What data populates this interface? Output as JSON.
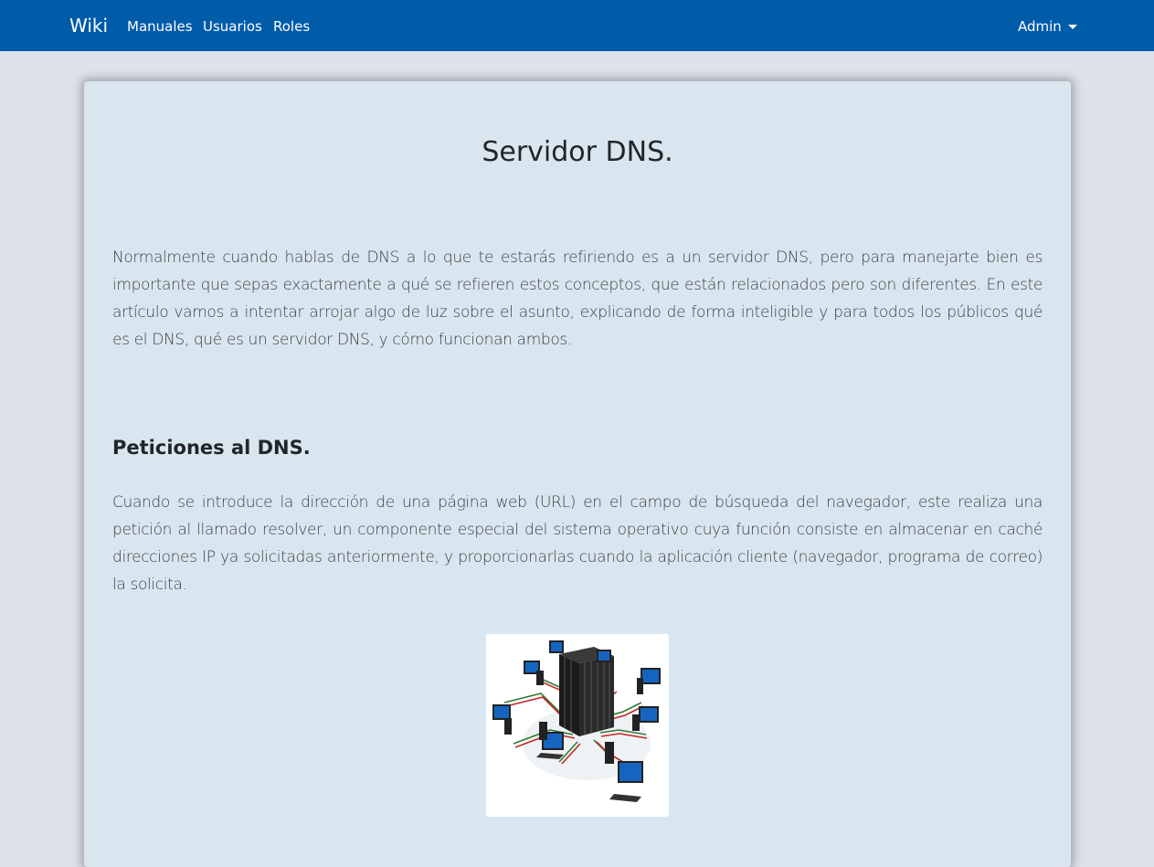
{
  "navbar": {
    "brand": "Wiki",
    "links": [
      "Manuales",
      "Usuarios",
      "Roles"
    ],
    "user_menu": "Admin",
    "user_menu_icon": "caret-down-icon",
    "color": "#005ba9"
  },
  "article": {
    "title": "Servidor DNS.",
    "intro": "Normalmente cuando hablas de DNS a lo que te estarás refiriendo es a un servidor DNS, pero para manejarte bien es importante que sepas exactamente a qué se refieren estos conceptos, que están relacionados pero son diferentes. En este artículo vamos a intentar arrojar algo de luz sobre el asunto, explicando de forma inteligible y para todos los públicos qué es el DNS, qué es un servidor DNS, y cómo funcionan ambos.",
    "section_heading": "Peticiones al DNS.",
    "section_body": "Cuando se introduce la dirección de una página web (URL) en el campo de búsqueda del navegador, este realiza una petición al llamado resolver, un componente especial del sistema operativo cuya función consiste en almacenar en caché direcciones IP ya solicitadas anteriormente, y proporcionarlas cuando la aplicación cliente (navegador, programa de correo) la solicita.",
    "figure_icon": "dns-server-network-illustration"
  },
  "colors": {
    "page_background": "#dde1e8",
    "card_background": "#dae6ef"
  }
}
